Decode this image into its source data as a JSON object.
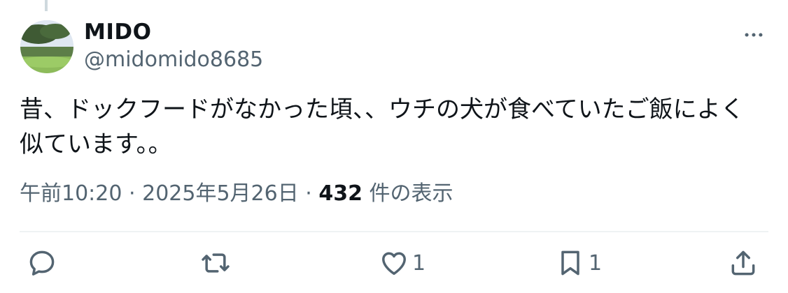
{
  "author": {
    "display_name": "MIDO",
    "handle": "@midomido8685",
    "avatar_icon": "avatar-landscape-photo"
  },
  "tweet": {
    "text": "昔、ドックフードがなかった頃、、ウチの犬が食べていたご飯によく似ています。。",
    "time": "午前10:20",
    "separator": "·",
    "date": "2025年5月26日",
    "views_count": "432",
    "views_label": "件の表示"
  },
  "actions": {
    "reply_icon": "reply-icon",
    "retweet_icon": "retweet-icon",
    "like_icon": "heart-icon",
    "like_count": "1",
    "bookmark_icon": "bookmark-icon",
    "bookmark_count": "1",
    "share_icon": "share-icon"
  },
  "colors": {
    "text": "#0f1419",
    "secondary": "#536471",
    "divider": "#eff3f4"
  }
}
